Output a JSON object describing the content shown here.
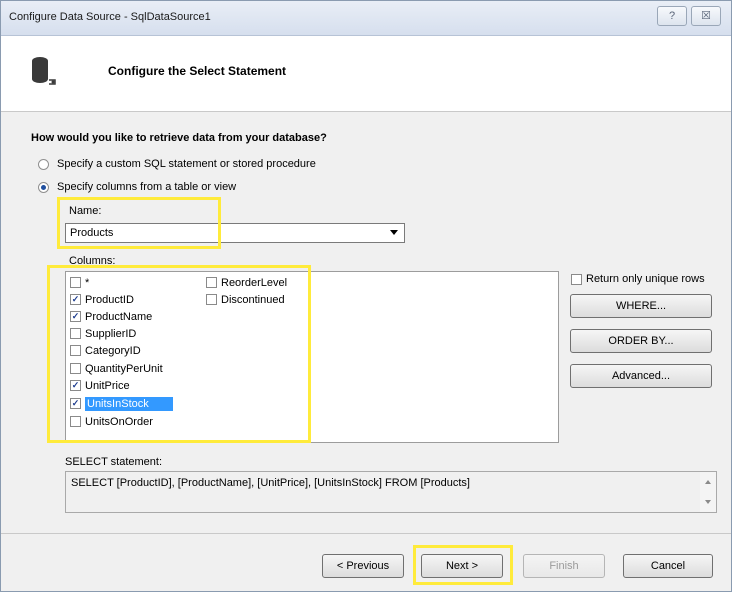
{
  "window": {
    "title": "Configure Data Source - SqlDataSource1",
    "help_glyph": "?",
    "close_glyph": "☒",
    "help_icon": "help-icon",
    "close_icon": "close-icon"
  },
  "header": {
    "title": "Configure the Select Statement",
    "icon": "database-icon"
  },
  "question": "How would you like to retrieve data from your database?",
  "options": [
    {
      "label": "Specify a custom SQL statement or stored procedure",
      "selected": false
    },
    {
      "label": "Specify columns from a table or view",
      "selected": true
    }
  ],
  "name_field": {
    "label": "Name:",
    "value": "Products"
  },
  "columns": {
    "label": "Columns:",
    "items": [
      {
        "name": "*",
        "checked": false,
        "selected": false
      },
      {
        "name": "ProductID",
        "checked": true,
        "selected": false
      },
      {
        "name": "ProductName",
        "checked": true,
        "selected": false
      },
      {
        "name": "SupplierID",
        "checked": false,
        "selected": false
      },
      {
        "name": "CategoryID",
        "checked": false,
        "selected": false
      },
      {
        "name": "QuantityPerUnit",
        "checked": false,
        "selected": false
      },
      {
        "name": "UnitPrice",
        "checked": true,
        "selected": false
      },
      {
        "name": "UnitsInStock",
        "checked": true,
        "selected": true
      },
      {
        "name": "UnitsOnOrder",
        "checked": false,
        "selected": false
      },
      {
        "name": "ReorderLevel",
        "checked": false,
        "selected": false
      },
      {
        "name": "Discontinued",
        "checked": false,
        "selected": false
      }
    ]
  },
  "side": {
    "unique_rows_label": "Return only unique rows",
    "unique_rows_checked": false,
    "where_label": "WHERE...",
    "order_by_label": "ORDER BY...",
    "advanced_label": "Advanced..."
  },
  "select_statement": {
    "label": "SELECT statement:",
    "text": "SELECT [ProductID], [ProductName], [UnitPrice], [UnitsInStock] FROM [Products]"
  },
  "buttons": {
    "previous": "< Previous",
    "next": "Next >",
    "finish": "Finish",
    "cancel": "Cancel"
  },
  "colors": {
    "highlight": "#ffeb3b",
    "selection": "#3399ff"
  }
}
